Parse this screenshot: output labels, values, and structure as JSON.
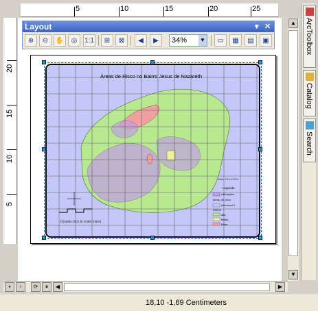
{
  "ruler_top": {
    "labels": [
      "5",
      "10",
      "15",
      "20",
      "25"
    ]
  },
  "ruler_left": {
    "labels": [
      "20",
      "15",
      "10",
      "5"
    ]
  },
  "layout_toolbar": {
    "title": "Layout",
    "controls": {
      "dropdown": "▾",
      "close": "✕"
    },
    "zoom_value": "34%",
    "zoom_arrow": "▼",
    "buttons": [
      "zoom-in-icon",
      "zoom-out-icon",
      "pan-icon",
      "full-extent-icon",
      "actual-size-icon",
      "fixed-zoom-in-icon",
      "fixed-zoom-out-icon",
      "back-icon",
      "forward-icon",
      "toggle-draft-icon",
      "focus-data-frame-icon",
      "change-layout-icon",
      "data-driven-pages-icon"
    ]
  },
  "map": {
    "title": "Áreas de Risco no Bairro Jesus de Nazareth",
    "hint": "Double-click to enter insert",
    "date": "Data: 20/11/2013",
    "legend_title": "Legenda",
    "legend_items": [
      "edificações",
      "áreas_de_risco",
      "lotes nivel 2",
      "RISCO",
      "Alto",
      "Médio",
      "Baixo"
    ],
    "colors": {
      "water": "#c4c8f8",
      "land": "#b8e890",
      "risk": "#f0a0a0",
      "buildings": "#c0a0e0",
      "grid": "#606060",
      "medium": "#f0f0a0"
    }
  },
  "dock": {
    "tabs": [
      "ArcToolbox",
      "Catalog",
      "Search"
    ]
  },
  "status": {
    "coordinates": "18,10  -1,69 Centimeters"
  }
}
